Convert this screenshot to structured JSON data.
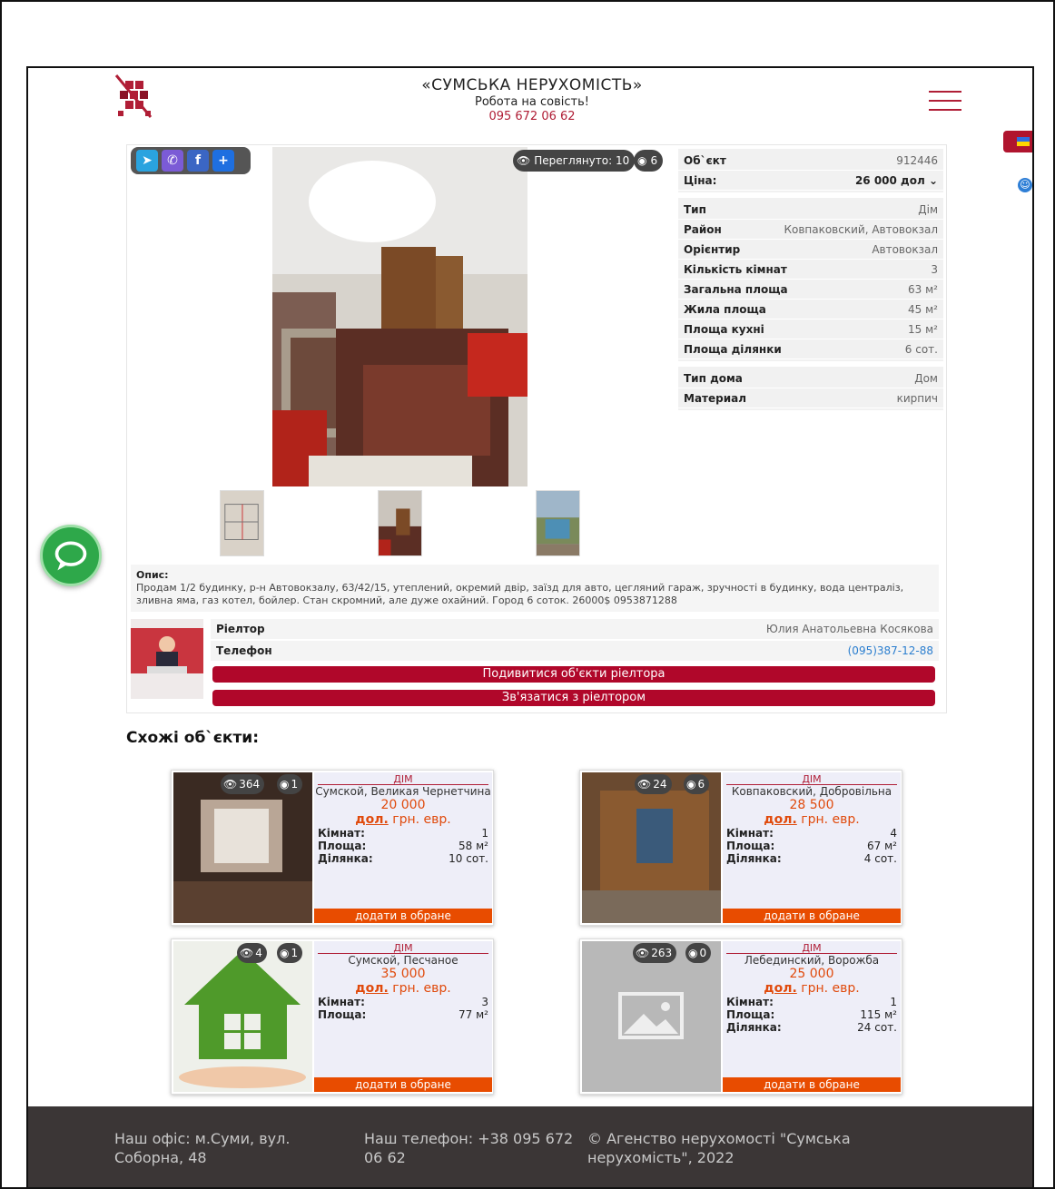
{
  "header": {
    "title": "«СУМСЬКА НЕРУХОМІСТЬ»",
    "subtitle": "Робота на совість!",
    "phone": "095 672 06 62"
  },
  "listing": {
    "views_label": "Переглянуто: 10",
    "photos_count": "6",
    "props_top": [
      {
        "k": "Об`єкт",
        "v": "912446"
      },
      {
        "k": "Ціна:",
        "v": "26 000 дол ⌄"
      }
    ],
    "props_main": [
      {
        "k": "Тип",
        "v": "Дім"
      },
      {
        "k": "Район",
        "v": "Ковпаковский, Автовокзал"
      },
      {
        "k": "Орієнтир",
        "v": "Автовокзал"
      },
      {
        "k": "Кількість кімнат",
        "v": "3"
      },
      {
        "k": "Загальна площа",
        "v": "63 м²"
      },
      {
        "k": "Жила площа",
        "v": "45 м²"
      },
      {
        "k": "Площа кухні",
        "v": "15 м²"
      },
      {
        "k": "Площа ділянки",
        "v": "6 сот."
      }
    ],
    "props_extra": [
      {
        "k": "Тип дома",
        "v": "Дом"
      },
      {
        "k": "Материал",
        "v": "кирпич"
      }
    ],
    "desc_label": "Опис:",
    "description": "Продам 1/2 будинку, р-н Автовокзалу, 63/42/15, утеплений, окремий двір, заїзд для авто, цегляний гараж, зручності в будинку, вода централіз, зливна яма, газ котел, бойлер. Стан скромний, але дуже охайний. Город 6 соток. 26000$ 0953871288"
  },
  "realtor": {
    "label": "Ріелтор",
    "name": "Юлия Анатольевна Косякова",
    "phone_label": "Телефон",
    "phone": "(095)387-12-88",
    "btn_objects": "Подивитися об'єкти ріелтора",
    "btn_contact": "Зв'язатися з ріелтором"
  },
  "similar": {
    "title": "Схожі об`єкти:",
    "fav_label": "додати в обране",
    "type": "ДІМ",
    "cur_sel": "дол.",
    "cur_rest": "грн. евр.",
    "items": [
      {
        "views": "364",
        "photos": "1",
        "loc": "Сумской, Великая Чернетчина",
        "price": "20 000",
        "rows": [
          {
            "k": "Кімнат:",
            "v": "1"
          },
          {
            "k": "Площа:",
            "v": "58 м²"
          },
          {
            "k": "Ділянка:",
            "v": "10 сот."
          }
        ]
      },
      {
        "views": "24",
        "photos": "6",
        "loc": "Ковпаковский, Добровільна",
        "price": "28 500",
        "rows": [
          {
            "k": "Кімнат:",
            "v": "4"
          },
          {
            "k": "Площа:",
            "v": "67 м²"
          },
          {
            "k": "Ділянка:",
            "v": "4 сот."
          }
        ]
      },
      {
        "views": "4",
        "photos": "1",
        "loc": "Сумской, Песчаное",
        "price": "35 000",
        "rows": [
          {
            "k": "Кімнат:",
            "v": "3"
          },
          {
            "k": "Площа:",
            "v": "77 м²"
          }
        ]
      },
      {
        "views": "263",
        "photos": "0",
        "loc": "Лебединский, Ворожба",
        "price": "25 000",
        "rows": [
          {
            "k": "Кімнат:",
            "v": "1"
          },
          {
            "k": "Площа:",
            "v": "115 м²"
          },
          {
            "k": "Ділянка:",
            "v": "24 сот."
          }
        ]
      }
    ]
  },
  "footer": {
    "office": "Наш офіс: м.Суми, вул. Соборна, 48",
    "phone": "Наш телефон: +38 095 672 06 62",
    "copyright": "© Агенство нерухомості \"Сумська нерухомість\", 2022"
  },
  "colors": {
    "brand": "#b01e36",
    "button": "#b0072a",
    "fav": "#e84c00",
    "footer_bg": "#3b3636",
    "chat": "#2ea84a"
  }
}
